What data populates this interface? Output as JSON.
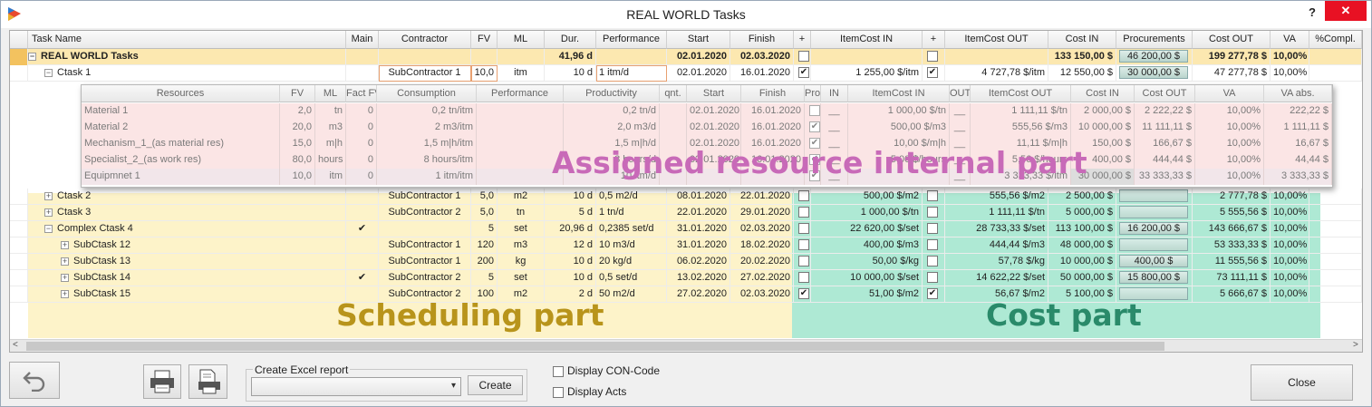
{
  "window": {
    "title": "REAL WORLD Tasks",
    "help": "?",
    "close": "✕"
  },
  "columns": [
    "Task Name",
    "Main",
    "Contractor",
    "FV",
    "ML",
    "Dur.",
    "Performance",
    "Start",
    "Finish",
    "+",
    "ItemCost IN",
    "+",
    "ItemCost OUT",
    "Cost IN",
    "Procurements",
    "Cost OUT",
    "VA",
    "%Compl."
  ],
  "tasks": [
    {
      "name": "REAL WORLD Tasks",
      "main": "",
      "contractor": "",
      "fv": "",
      "ml": "",
      "dur": "41,96 d",
      "perf": "",
      "start": "02.01.2020",
      "finish": "02.03.2020",
      "cb1": false,
      "icin": "",
      "cb2": false,
      "icout": "",
      "costin": "133 150,00 $",
      "proc": "46 200,00 $",
      "costout": "199 277,78 $",
      "va": "10,00%",
      "pct": "",
      "level": 0,
      "bold": true,
      "sel": true
    },
    {
      "name": "Ctask 1",
      "main": "",
      "contractor": "SubContractor 1",
      "fv": "10,0",
      "ml": "itm",
      "dur": "10 d",
      "perf": "1 itm/d",
      "start": "02.01.2020",
      "finish": "16.01.2020",
      "cb1": true,
      "icin": "1 255,00 $/itm",
      "cb2": true,
      "icout": "4 727,78 $/itm",
      "costin": "12 550,00 $",
      "proc": "30 000,00 $",
      "costout": "47 277,78 $",
      "va": "10,00%",
      "pct": "",
      "level": 1,
      "bold": false,
      "sel": false
    },
    {
      "name": "Ctask 2",
      "main": "",
      "contractor": "SubContractor 1",
      "fv": "5,0",
      "ml": "m2",
      "dur": "10 d",
      "perf": "0,5 m2/d",
      "start": "08.01.2020",
      "finish": "22.01.2020",
      "cb1": false,
      "icin": "500,00 $/m2",
      "cb2": false,
      "icout": "555,56 $/m2",
      "costin": "2 500,00 $",
      "proc": "",
      "costout": "2 777,78 $",
      "va": "10,00%",
      "pct": "",
      "level": 1,
      "bold": false,
      "sel": false
    },
    {
      "name": "Ctask 3",
      "main": "",
      "contractor": "SubContractor 2",
      "fv": "5,0",
      "ml": "tn",
      "dur": "5 d",
      "perf": "1 tn/d",
      "start": "22.01.2020",
      "finish": "29.01.2020",
      "cb1": false,
      "icin": "1 000,00 $/tn",
      "cb2": false,
      "icout": "1 111,11 $/tn",
      "costin": "5 000,00 $",
      "proc": "",
      "costout": "5 555,56 $",
      "va": "10,00%",
      "pct": "",
      "level": 1,
      "bold": false,
      "sel": false
    },
    {
      "name": "Complex Ctask 4",
      "main": "✔",
      "contractor": "",
      "fv": "5",
      "ml": "set",
      "dur": "20,96 d",
      "perf": "0,2385 set/d",
      "start": "31.01.2020",
      "finish": "02.03.2020",
      "cb1": false,
      "icin": "22 620,00 $/set",
      "cb2": false,
      "icout": "28 733,33 $/set",
      "costin": "113 100,00 $",
      "proc": "16 200,00 $",
      "costout": "143 666,67 $",
      "va": "10,00%",
      "pct": "",
      "level": 1,
      "bold": false,
      "sel": false
    },
    {
      "name": "SubCtask 12",
      "main": "",
      "contractor": "SubContractor 1",
      "fv": "120",
      "ml": "m3",
      "dur": "12 d",
      "perf": "10 m3/d",
      "start": "31.01.2020",
      "finish": "18.02.2020",
      "cb1": false,
      "icin": "400,00 $/m3",
      "cb2": false,
      "icout": "444,44 $/m3",
      "costin": "48 000,00 $",
      "proc": "",
      "costout": "53 333,33 $",
      "va": "10,00%",
      "pct": "",
      "level": 2,
      "bold": false,
      "sel": false
    },
    {
      "name": "SubCtask 13",
      "main": "",
      "contractor": "SubContractor 1",
      "fv": "200",
      "ml": "kg",
      "dur": "10 d",
      "perf": "20 kg/d",
      "start": "06.02.2020",
      "finish": "20.02.2020",
      "cb1": false,
      "icin": "50,00 $/kg",
      "cb2": false,
      "icout": "57,78 $/kg",
      "costin": "10 000,00 $",
      "proc": "400,00 $",
      "costout": "11 555,56 $",
      "va": "10,00%",
      "pct": "",
      "level": 2,
      "bold": false,
      "sel": false
    },
    {
      "name": "SubCtask 14",
      "main": "✔",
      "contractor": "SubContractor 2",
      "fv": "5",
      "ml": "set",
      "dur": "10 d",
      "perf": "0,5 set/d",
      "start": "13.02.2020",
      "finish": "27.02.2020",
      "cb1": false,
      "icin": "10 000,00 $/set",
      "cb2": false,
      "icout": "14 622,22 $/set",
      "costin": "50 000,00 $",
      "proc": "15 800,00 $",
      "costout": "73 111,11 $",
      "va": "10,00%",
      "pct": "",
      "level": 2,
      "bold": false,
      "sel": false
    },
    {
      "name": "SubCtask 15",
      "main": "",
      "contractor": "SubContractor 2",
      "fv": "100",
      "ml": "m2",
      "dur": "2 d",
      "perf": "50 m2/d",
      "start": "27.02.2020",
      "finish": "02.03.2020",
      "cb1": true,
      "icin": "51,00 $/m2",
      "cb2": true,
      "icout": "56,67 $/m2",
      "costin": "5 100,00 $",
      "proc": "",
      "costout": "5 666,67 $",
      "va": "10,00%",
      "pct": "",
      "level": 2,
      "bold": false,
      "sel": false
    }
  ],
  "resources": {
    "columns": [
      "Resources",
      "FV",
      "ML",
      "Fact FV",
      "Consumption",
      "Performance",
      "Productivity",
      "qnt.",
      "Start",
      "Finish",
      "Pro...",
      "IN",
      "ItemCost IN",
      "OUT",
      "ItemCost OUT",
      "Cost IN",
      "Cost OUT",
      "VA",
      "VA abs."
    ],
    "rows": [
      {
        "name": "Material 1",
        "fv": "2,0",
        "ml": "tn",
        "fact": "0",
        "cons": "0,2 tn/itm",
        "perf": "",
        "prod": "0,2 tn/d",
        "qnt": "",
        "start": "02.01.2020",
        "finish": "16.01.2020",
        "pro": false,
        "in": "__",
        "icin": "1 000,00 $/tn",
        "out": "__",
        "icout": "1 111,11 $/tn",
        "costin": "2 000,00 $",
        "costout": "2 222,22 $",
        "va": "10,00%",
        "vaabs": "222,22 $",
        "bg": "#fbe5e5"
      },
      {
        "name": "Material 2",
        "fv": "20,0",
        "ml": "m3",
        "fact": "0",
        "cons": "2 m3/itm",
        "perf": "",
        "prod": "2,0 m3/d",
        "qnt": "",
        "start": "02.01.2020",
        "finish": "16.01.2020",
        "pro": true,
        "in": "__",
        "icin": "500,00 $/m3",
        "out": "__",
        "icout": "555,56 $/m3",
        "costin": "10 000,00 $",
        "costout": "11 111,11 $",
        "va": "10,00%",
        "vaabs": "1 111,11 $",
        "bg": "#fbe5e5"
      },
      {
        "name": "Mechanism_1_(as material res)",
        "fv": "15,0",
        "ml": "m|h",
        "fact": "0",
        "cons": "1,5 m|h/itm",
        "perf": "",
        "prod": "1,5 m|h/d",
        "qnt": "",
        "start": "02.01.2020",
        "finish": "16.01.2020",
        "pro": true,
        "in": "__",
        "icin": "10,00 $/m|h",
        "out": "__",
        "icout": "11,11 $/m|h",
        "costin": "150,00 $",
        "costout": "166,67 $",
        "va": "10,00%",
        "vaabs": "16,67 $",
        "bg": "#fbe5e5"
      },
      {
        "name": "Specialist_2_(as work res)",
        "fv": "80,0",
        "ml": "hours",
        "fact": "0",
        "cons": "8 hours/itm",
        "perf": "",
        "prod": "8 hours/d",
        "qnt": "",
        "start": "02.01.2020",
        "finish": "16.01.2020",
        "pro": true,
        "in": "__",
        "icin": "5,00 $/hours",
        "out": "__",
        "icout": "5,56 $/hours",
        "costin": "400,00 $",
        "costout": "444,44 $",
        "va": "10,00%",
        "vaabs": "44,44 $",
        "bg": "#fbe5e5"
      },
      {
        "name": "Equipmnet 1",
        "fv": "10,0",
        "ml": "itm",
        "fact": "0",
        "cons": "1 itm/itm",
        "perf": "",
        "prod": "10 itm/d",
        "qnt": "",
        "start": "",
        "finish": "",
        "pro": true,
        "in": "__",
        "icin": "",
        "out": "__",
        "icout": "3 333,33 $/itm",
        "costin": "30 000,00 $",
        "costout": "33 333,33 $",
        "va": "10,00%",
        "vaabs": "3 333,33 $",
        "bg": "#f2e6ea"
      }
    ]
  },
  "labels": {
    "resource_overlay": "Assigned resource internal part",
    "scheduling": "Scheduling part",
    "cost": "Cost part"
  },
  "bottom": {
    "excel_label": "Create Excel report",
    "excel_selected": "",
    "create": "Create",
    "con_code": "Display CON-Code",
    "acts": "Display Acts",
    "close": "Close"
  },
  "colors": {
    "scheduling_bg": "#fdf3c9",
    "cost_bg": "#aee9d4",
    "overlay_text": "#c86ab8",
    "scheduling_text": "#b8941b",
    "cost_text": "#2a8a6a",
    "selected_row": "#fce8b0"
  }
}
